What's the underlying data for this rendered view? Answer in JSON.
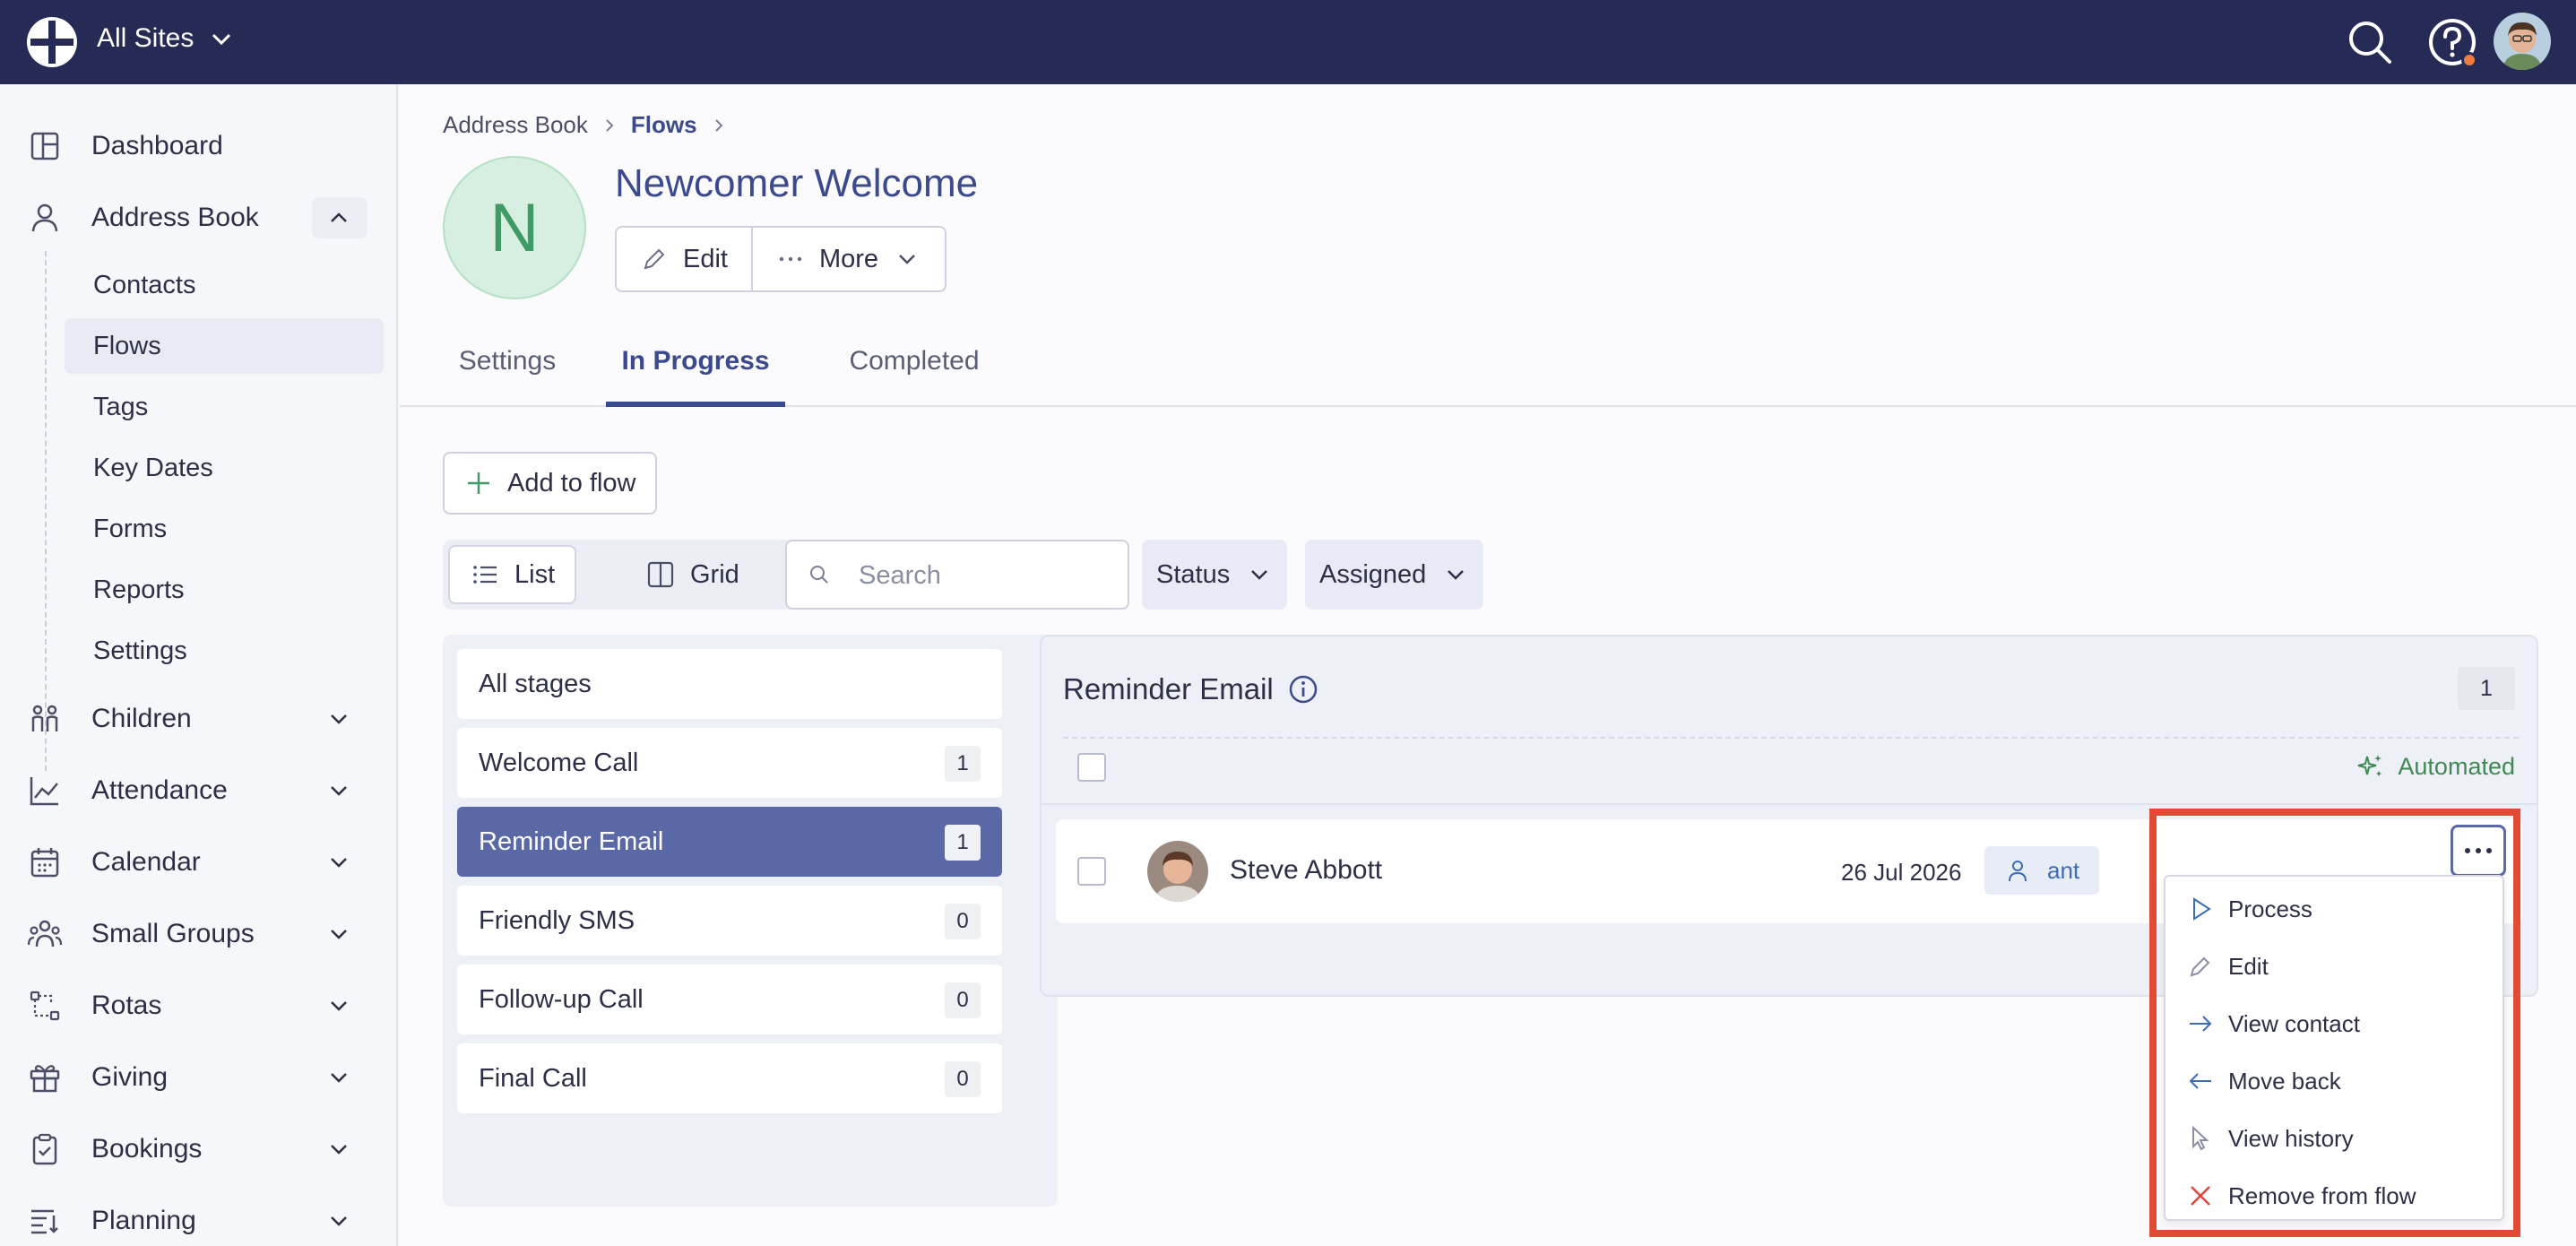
{
  "topbar": {
    "site_label": "All Sites",
    "icons": [
      "logo-icon",
      "search-icon",
      "help-icon",
      "user-avatar"
    ]
  },
  "sidebar": {
    "items": [
      {
        "label": "Dashboard",
        "icon": "dashboard-icon"
      },
      {
        "label": "Address Book",
        "icon": "person-icon",
        "expanded": true
      },
      {
        "label": "Children",
        "icon": "children-icon"
      },
      {
        "label": "Attendance",
        "icon": "chart-icon"
      },
      {
        "label": "Calendar",
        "icon": "calendar-icon"
      },
      {
        "label": "Small Groups",
        "icon": "group-icon"
      },
      {
        "label": "Rotas",
        "icon": "rota-icon"
      },
      {
        "label": "Giving",
        "icon": "gift-icon"
      },
      {
        "label": "Bookings",
        "icon": "clipboard-icon"
      },
      {
        "label": "Planning",
        "icon": "planning-icon"
      }
    ],
    "address_book_sub": [
      "Contacts",
      "Flows",
      "Tags",
      "Key Dates",
      "Forms",
      "Reports",
      "Settings"
    ],
    "active_sub": "Flows"
  },
  "breadcrumb": {
    "items": [
      "Address Book",
      "Flows"
    ]
  },
  "flow": {
    "initial": "N",
    "title": "Newcomer Welcome",
    "edit_label": "Edit",
    "more_label": "More"
  },
  "tabs": [
    "Settings",
    "In Progress",
    "Completed"
  ],
  "active_tab": "In Progress",
  "toolbar": {
    "add_label": "Add to flow",
    "list_label": "List",
    "grid_label": "Grid",
    "search_placeholder": "Search",
    "status_label": "Status",
    "assigned_label": "Assigned"
  },
  "stages": [
    {
      "label": "All stages",
      "count": null
    },
    {
      "label": "Welcome Call",
      "count": "1"
    },
    {
      "label": "Reminder Email",
      "count": "1",
      "active": true
    },
    {
      "label": "Friendly SMS",
      "count": "0"
    },
    {
      "label": "Follow-up Call",
      "count": "0"
    },
    {
      "label": "Final Call",
      "count": "0"
    }
  ],
  "detail": {
    "title": "Reminder Email",
    "count": "1",
    "automated_label": "Automated",
    "rows": [
      {
        "name": "Steve Abbott",
        "date": "26 Jul 2026",
        "assignee": "ant"
      }
    ]
  },
  "context_menu": {
    "items": [
      {
        "label": "Process",
        "icon": "play-icon"
      },
      {
        "label": "Edit",
        "icon": "pencil-icon"
      },
      {
        "label": "View contact",
        "icon": "arrow-right-icon"
      },
      {
        "label": "Move back",
        "icon": "arrow-left-icon"
      },
      {
        "label": "View history",
        "icon": "cursor-icon"
      },
      {
        "label": "Remove from flow",
        "icon": "x-icon"
      }
    ]
  },
  "colors": {
    "topbar": "#262b55",
    "accent": "#3b4a8c",
    "active_stage": "#5b68a6",
    "automated": "#3f8a52",
    "highlight": "#e34a33",
    "remove": "#e0463c"
  }
}
